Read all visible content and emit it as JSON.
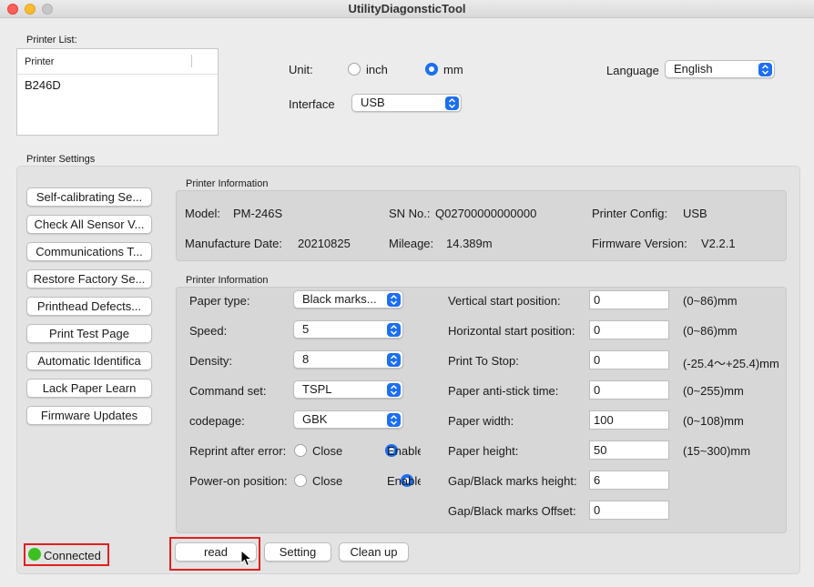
{
  "window": {
    "title": "UtilityDiagonsticTool"
  },
  "printer_list": {
    "label": "Printer List:",
    "column_header": "Printer",
    "items": [
      "B246D"
    ]
  },
  "unit": {
    "label": "Unit:",
    "options": [
      "inch",
      "mm"
    ],
    "selected": "mm"
  },
  "interface": {
    "label": "Interface",
    "value": "USB"
  },
  "language": {
    "label": "Language",
    "value": "English"
  },
  "printer_settings_label": "Printer Settings",
  "side_buttons": [
    "Self-calibrating Se...",
    "Check All Sensor V...",
    "Communications T...",
    "Restore Factory Se...",
    "Printhead Defects...",
    "Print Test Page",
    "Automatic Identifica",
    "Lack Paper Learn",
    "Firmware Updates"
  ],
  "info": {
    "title": "Printer Information",
    "model_label": "Model:",
    "model": "PM-246S",
    "sn_label": "SN No.:",
    "sn": "Q02700000000000",
    "config_label": "Printer Config:",
    "config": "USB",
    "mfg_label": "Manufacture Date:",
    "mfg": "20210825",
    "mileage_label": "Mileage:",
    "mileage": "14.389m",
    "fw_label": "Firmware Version:",
    "fw": "V2.2.1"
  },
  "settings": {
    "title": "Printer Information",
    "left": [
      {
        "label": "Paper type:",
        "value": "Black marks..."
      },
      {
        "label": "Speed:",
        "value": "5"
      },
      {
        "label": "Density:",
        "value": "8"
      },
      {
        "label": "Command set:",
        "value": "TSPL"
      },
      {
        "label": "codepage:",
        "value": "GBK"
      }
    ],
    "reprint": {
      "label": "Reprint after error:",
      "close": "Close",
      "enable": "Enable",
      "selected": "Enable"
    },
    "poweron": {
      "label": "Power-on position:",
      "close": "Close",
      "enable": "Enable",
      "selected": "Enable"
    },
    "right": [
      {
        "label": "Vertical start position:",
        "value": "0",
        "range": "(0~86)mm"
      },
      {
        "label": "Horizontal start position:",
        "value": "0",
        "range": "(0~86)mm"
      },
      {
        "label": "Print To Stop:",
        "value": "0",
        "range": "(-25.4～+25.4)mm"
      },
      {
        "label": "Paper anti-stick time:",
        "value": "0",
        "range": "(0~255)mm"
      },
      {
        "label": "Paper width:",
        "value": "100",
        "range": "(0~108)mm"
      },
      {
        "label": "Paper height:",
        "value": "50",
        "range": "(15~300)mm"
      },
      {
        "label": "Gap/Black marks height:",
        "value": "6",
        "range": ""
      },
      {
        "label": "Gap/Black marks Offset:",
        "value": "0",
        "range": ""
      }
    ]
  },
  "status": {
    "text": "Connected",
    "color": "#3cc01f"
  },
  "actions": {
    "read": "read",
    "setting": "Setting",
    "clean": "Clean up"
  },
  "colors": {
    "accent": "#1c6ef2",
    "highlight": "#e02020"
  }
}
